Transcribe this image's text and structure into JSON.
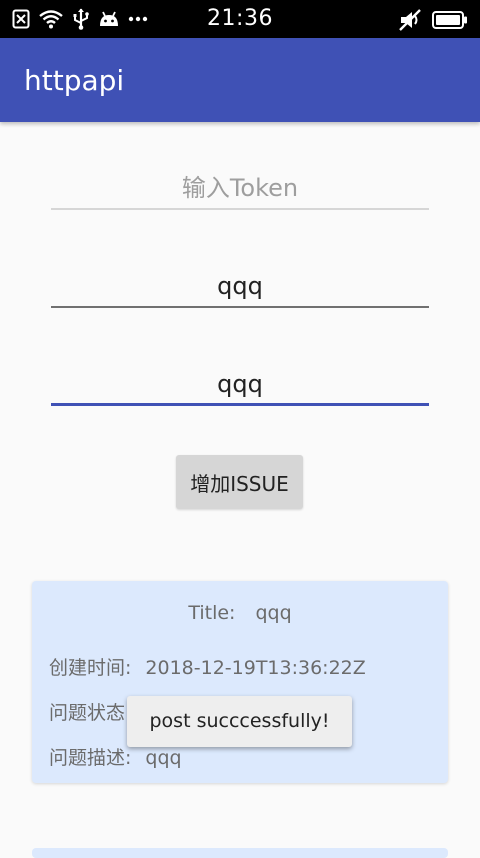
{
  "status_bar": {
    "time": "21:36",
    "icons_left": [
      "sim-error-icon",
      "wifi-icon",
      "usb-icon",
      "android-icon",
      "more-dots-icon"
    ],
    "icons_right": [
      "mute-icon",
      "battery-icon"
    ]
  },
  "app_bar": {
    "title": "httpapi"
  },
  "form": {
    "token_placeholder": "输入Token",
    "token_value": "",
    "title_value": "qqq",
    "desc_value": "qqq",
    "add_button_label": "增加ISSUE"
  },
  "issue_card": {
    "title_label": "Title:",
    "title_value": "qqq",
    "created_label": "创建时间:",
    "created_value": "2018-12-19T13:36:22Z",
    "state_label": "问题状态",
    "desc_label": "问题描述:",
    "desc_value": "qqq"
  },
  "toast": {
    "message": "post succcessfully!"
  },
  "colors": {
    "primary": "#3f51b5",
    "card_bg": "#dce9fd",
    "button_bg": "#d6d6d6"
  }
}
